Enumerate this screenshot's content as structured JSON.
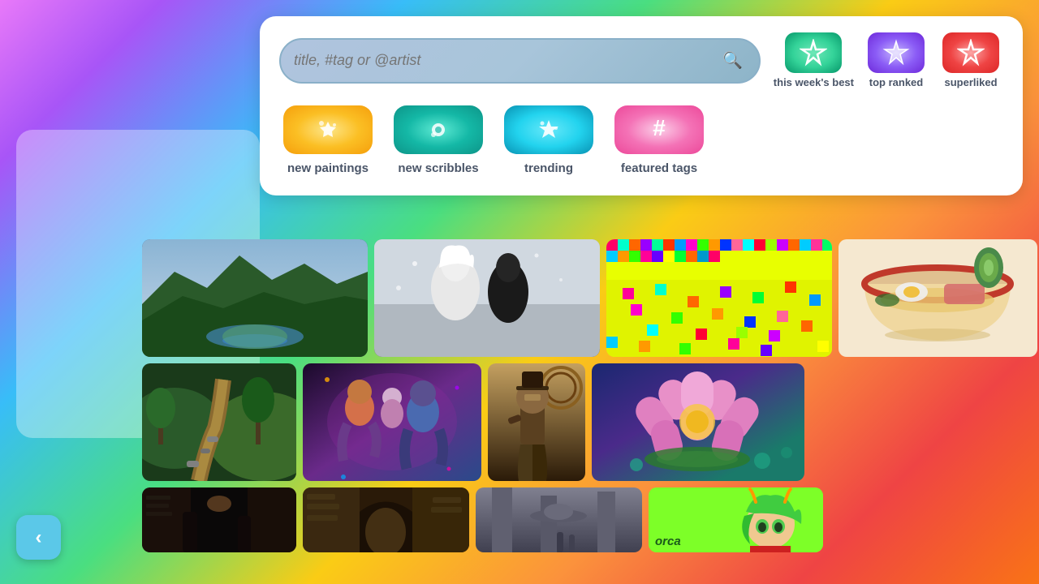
{
  "background": {
    "gradient": "multicolor"
  },
  "search": {
    "placeholder": "title, #tag or @artist",
    "icon": "🔍"
  },
  "top_categories": [
    {
      "id": "this-weeks-best",
      "label": "this week's best",
      "icon": "☆",
      "color": "green"
    },
    {
      "id": "top-ranked",
      "label": "top ranked",
      "icon": "⭐",
      "color": "purple"
    },
    {
      "id": "superliked",
      "label": "superliked",
      "icon": "✩",
      "color": "red"
    }
  ],
  "bottom_categories": [
    {
      "id": "new-paintings",
      "label": "new paintings",
      "icon": "✦",
      "color": "yellow"
    },
    {
      "id": "new-scribbles",
      "label": "new scribbles",
      "icon": "●",
      "color": "teal"
    },
    {
      "id": "trending",
      "label": "trending",
      "icon": "✦",
      "color": "cyan"
    },
    {
      "id": "featured-tags",
      "label": "featured tags",
      "icon": "#",
      "color": "pink"
    }
  ],
  "back_button": {
    "label": "‹"
  },
  "artwork": {
    "row1": [
      {
        "id": "art-1",
        "description": "landscape mountain river"
      },
      {
        "id": "art-2",
        "description": "anime characters white hair"
      },
      {
        "id": "art-3",
        "description": "colorful pixel art"
      },
      {
        "id": "art-4",
        "description": "ramen bowl food"
      }
    ],
    "row2": [
      {
        "id": "art-5",
        "description": "green path landscape"
      },
      {
        "id": "art-6",
        "description": "colorful dance scene"
      },
      {
        "id": "art-7",
        "description": "steampunk character"
      },
      {
        "id": "art-8",
        "description": "lotus flower pixel art"
      }
    ],
    "row3": [
      {
        "id": "art-9",
        "description": "dark alley scene"
      },
      {
        "id": "art-10",
        "description": "stone archway"
      },
      {
        "id": "art-11",
        "description": "sci-fi scene"
      },
      {
        "id": "art-12",
        "description": "anime character green",
        "badge": "orca"
      }
    ]
  }
}
